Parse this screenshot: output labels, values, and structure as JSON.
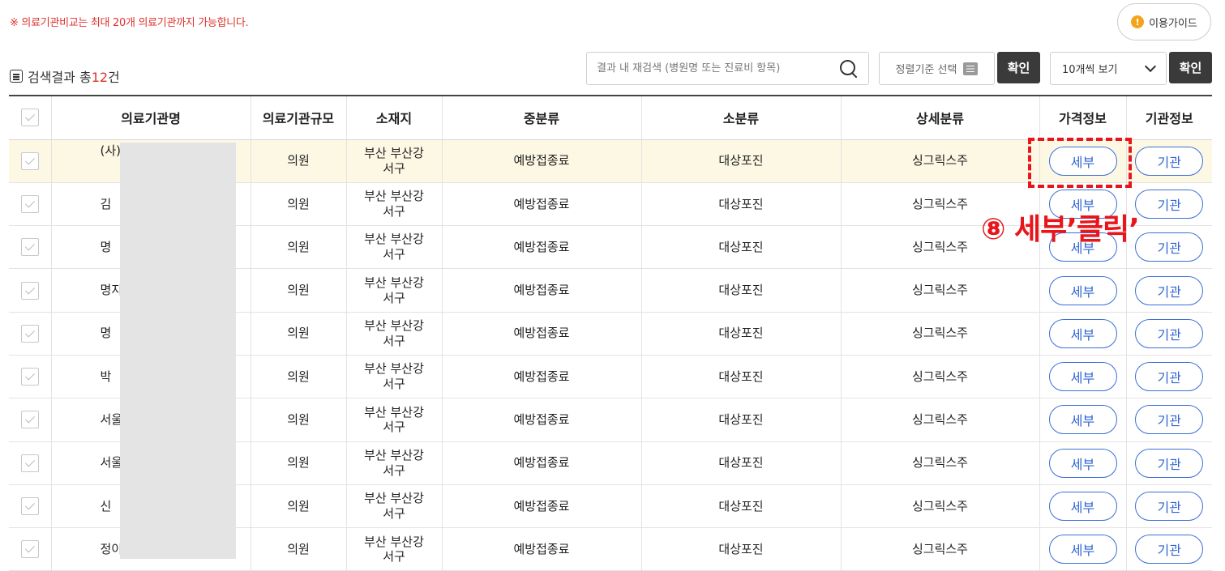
{
  "notice": "※ 의료기관비교는 최대 20개 의료기관까지 가능합니다.",
  "guide_button": {
    "label": "이용가이드",
    "icon": "info-icon"
  },
  "result": {
    "prefix": "검색결과 총",
    "count": "12",
    "suffix": "건"
  },
  "search": {
    "placeholder": "결과 내 재검색 (병원명 또는 진료비 항목)"
  },
  "sort": {
    "label": "정렬기준 선택"
  },
  "confirm_label": "확인",
  "page_size": {
    "selected": "10개씩 보기"
  },
  "table": {
    "columns": [
      "의료기관명",
      "의료기관규모",
      "소재지",
      "중분류",
      "소분류",
      "상세분류",
      "가격정보",
      "기관정보"
    ],
    "rows": [
      {
        "name": "(사)대한",
        "size": "의원",
        "loc1": "부산 부산강",
        "loc2": "서구",
        "mid": "예방접종료",
        "small": "대상포진",
        "detail": "싱그릭스주",
        "price_btn": "세부",
        "org_btn": "기관"
      },
      {
        "name": "김",
        "size": "의원",
        "loc1": "부산 부산강",
        "loc2": "서구",
        "mid": "예방접종료",
        "small": "대상포진",
        "detail": "싱그릭스주",
        "price_btn": "세부",
        "org_btn": "기관"
      },
      {
        "name": "명",
        "size": "의원",
        "loc1": "부산 부산강",
        "loc2": "서구",
        "mid": "예방접종료",
        "small": "대상포진",
        "detail": "싱그릭스주",
        "price_btn": "세부",
        "org_btn": "기관"
      },
      {
        "name": "명지웰ㅁ",
        "size": "의원",
        "loc1": "부산 부산강",
        "loc2": "서구",
        "mid": "예방접종료",
        "small": "대상포진",
        "detail": "싱그릭스주",
        "price_btn": "세부",
        "org_btn": "기관"
      },
      {
        "name": "명",
        "size": "의원",
        "loc1": "부산 부산강",
        "loc2": "서구",
        "mid": "예방접종료",
        "small": "대상포진",
        "detail": "싱그릭스주",
        "price_btn": "세부",
        "org_btn": "기관"
      },
      {
        "name": "박",
        "size": "의원",
        "loc1": "부산 부산강",
        "loc2": "서구",
        "mid": "예방접종료",
        "small": "대상포진",
        "detail": "싱그릭스주",
        "price_btn": "세부",
        "org_btn": "기관"
      },
      {
        "name": "서울",
        "size": "의원",
        "loc1": "부산 부산강",
        "loc2": "서구",
        "mid": "예방접종료",
        "small": "대상포진",
        "detail": "싱그릭스주",
        "price_btn": "세부",
        "org_btn": "기관"
      },
      {
        "name": "서울",
        "size": "의원",
        "loc1": "부산 부산강",
        "loc2": "서구",
        "mid": "예방접종료",
        "small": "대상포진",
        "detail": "싱그릭스주",
        "price_btn": "세부",
        "org_btn": "기관"
      },
      {
        "name": "신",
        "size": "의원",
        "loc1": "부산 부산강",
        "loc2": "서구",
        "mid": "예방접종료",
        "small": "대상포진",
        "detail": "싱그릭스주",
        "price_btn": "세부",
        "org_btn": "기관"
      },
      {
        "name": "정이",
        "size": "의원",
        "loc1": "부산 부산강",
        "loc2": "서구",
        "mid": "예방접종료",
        "small": "대상포진",
        "detail": "싱그릭스주",
        "price_btn": "세부",
        "org_btn": "기관"
      }
    ]
  },
  "annotation": "⑧ 세부’클릭’",
  "colors": {
    "accent_red": "#e8151b",
    "button_blue": "#2f64d2",
    "highlight_row": "#fdf8e4"
  }
}
